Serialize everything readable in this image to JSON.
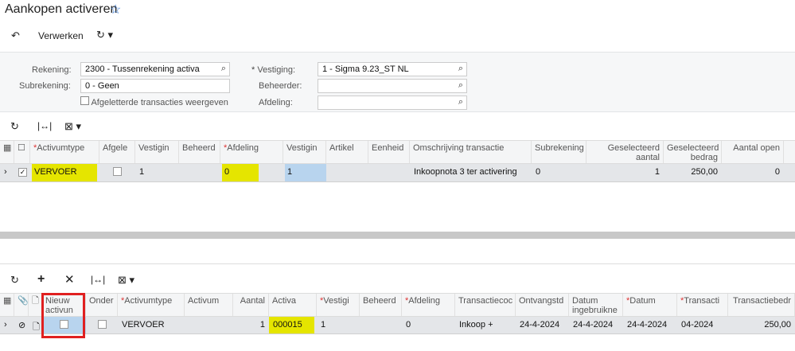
{
  "page": {
    "title": "Aankopen activeren"
  },
  "toolbar": {
    "process": "Verwerken"
  },
  "form": {
    "rekening_label": "Rekening:",
    "rekening_value": "2300 - Tussenrekening activa",
    "subrekening_label": "Subrekening:",
    "subrekening_value": "0 - Geen",
    "afgeletterd_label": "Afgeletterde transacties weergeven",
    "vestiging_label": "Vestiging:",
    "vestiging_value": "1 - Sigma 9.23_ST NL",
    "beheerder_label": "Beheerder:",
    "beheerder_value": "",
    "afdeling_label": "Afdeling:",
    "afdeling_value": ""
  },
  "top_grid": {
    "columns": [
      "",
      "",
      "Activumtype",
      "Afgele",
      "Vestigin",
      "Beheerd",
      "Afdeling",
      "Vestigin",
      "Artikel",
      "Eenheid",
      "Omschrijving transactie",
      "Subrekening",
      "Geselecteerd aantal",
      "Geselecteerd bedrag",
      "Aantal open"
    ],
    "required": [
      2,
      6
    ],
    "rows": [
      [
        "",
        "",
        "VERVOER",
        "",
        "1",
        "",
        "0",
        "1",
        "",
        "",
        "Inkoopnota 3 ter activering",
        "0",
        "1",
        "250,00",
        "0"
      ]
    ]
  },
  "bottom_grid": {
    "columns": [
      "",
      "",
      "",
      "Nieuw activun",
      "Onder",
      "Activumtype",
      "Activum",
      "Aantal",
      "Activa",
      "Vestigi",
      "Beheerd",
      "Afdeling",
      "Transactiecoc",
      "Ontvangstd",
      "Datum ingebruikne",
      "Datum",
      "Transacti",
      "Transactiebedr"
    ],
    "required": [
      5,
      9,
      11,
      15,
      16
    ],
    "rows": [
      [
        "",
        "",
        "",
        "",
        "",
        "VERVOER",
        "",
        "1",
        "000015",
        "1",
        "",
        "0",
        "Inkoop +",
        "24-4-2024",
        "24-4-2024",
        "24-4-2024",
        "04-2024",
        "250,00"
      ]
    ]
  },
  "colors": {
    "highlight": "#e5e500",
    "selected": "#b8d4ee",
    "annotation": "#e02020"
  }
}
